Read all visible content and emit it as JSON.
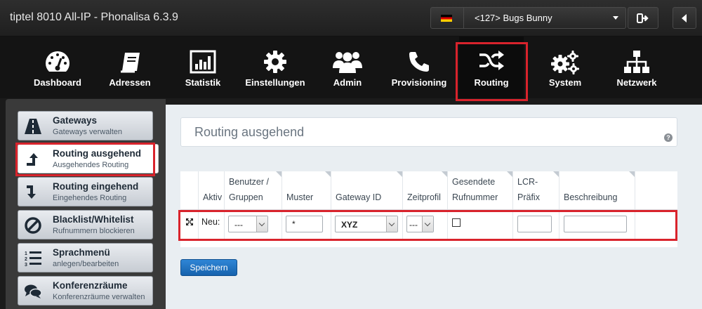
{
  "app": {
    "title": "tiptel 8010 All-IP - Phonalisa 6.3.9"
  },
  "header": {
    "user_select_value": "<127> Bugs Bunny"
  },
  "nav": {
    "items": [
      {
        "label": "Dashboard",
        "icon": "dashboard-icon"
      },
      {
        "label": "Adressen",
        "icon": "address-book-icon"
      },
      {
        "label": "Statistik",
        "icon": "statistics-icon"
      },
      {
        "label": "Einstellungen",
        "icon": "gear-icon"
      },
      {
        "label": "Admin",
        "icon": "users-icon"
      },
      {
        "label": "Provisioning",
        "icon": "phone-icon"
      },
      {
        "label": "Routing",
        "icon": "shuffle-icon"
      },
      {
        "label": "System",
        "icon": "gears-icon"
      },
      {
        "label": "Netzwerk",
        "icon": "network-icon"
      }
    ],
    "active": "Routing"
  },
  "sidebar": {
    "items": [
      {
        "title": "Gateways",
        "subtitle": "Gateways verwalten",
        "icon": "road-icon"
      },
      {
        "title": "Routing ausgehend",
        "subtitle": "Ausgehendes Routing",
        "icon": "arrow-up-icon"
      },
      {
        "title": "Routing eingehend",
        "subtitle": "Eingehendes Routing",
        "icon": "arrow-down-icon"
      },
      {
        "title": "Blacklist/Whitelist",
        "subtitle": "Rufnummern blockieren",
        "icon": "ban-icon"
      },
      {
        "title": "Sprachmenü",
        "subtitle": "anlegen/bearbeiten",
        "icon": "list-ol-icon"
      },
      {
        "title": "Konferenzräume",
        "subtitle": "Konferenzräume verwalten",
        "icon": "comments-icon"
      }
    ],
    "active": "Routing ausgehend"
  },
  "main": {
    "title": "Routing ausgehend",
    "help": "?",
    "table": {
      "headers": [
        "Aktiv",
        "Benutzer / Gruppen",
        "Muster",
        "Gateway ID",
        "Zeitprofil",
        "Gesendete Rufnummer",
        "LCR-Präfix",
        "Beschreibung"
      ],
      "new_row": {
        "label": "Neu:",
        "benutzer": "---",
        "muster": "*",
        "gateway": "XYZ",
        "zeitprofil": "---",
        "gesendete_rufnummer_checked": false,
        "lcr_praefix": "",
        "beschreibung": ""
      }
    },
    "save_label": "Speichern"
  },
  "colors": {
    "highlight": "#d9232c",
    "save_button": "#1e6fc0",
    "topbar": "#262626"
  }
}
